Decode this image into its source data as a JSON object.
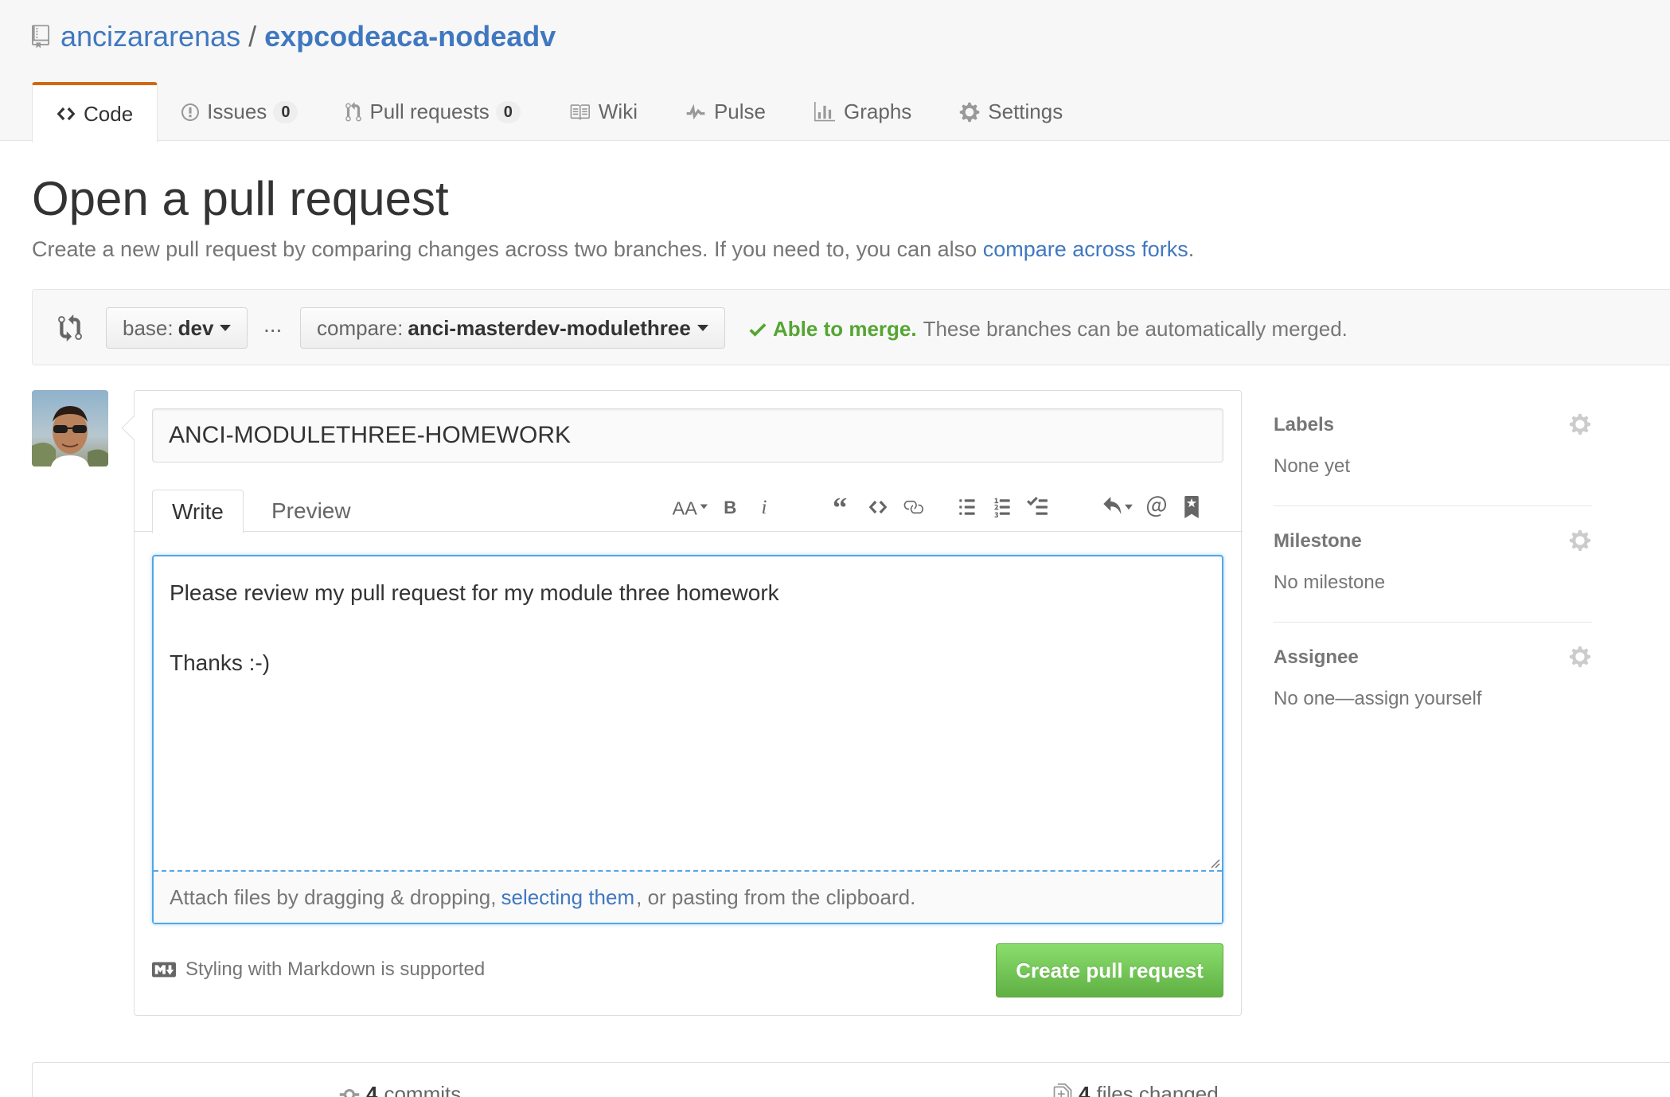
{
  "repo": {
    "owner": "ancizararenas",
    "separator": "/",
    "name": "expcodeaca-nodeadv"
  },
  "nav": {
    "code": "Code",
    "issues": "Issues",
    "issues_count": "0",
    "pulls": "Pull requests",
    "pulls_count": "0",
    "wiki": "Wiki",
    "pulse": "Pulse",
    "graphs": "Graphs",
    "settings": "Settings"
  },
  "page": {
    "title": "Open a pull request",
    "subtitle_prefix": "Create a new pull request by comparing changes across two branches. If you need to, you can also ",
    "subtitle_link": "compare across forks",
    "subtitle_suffix": "."
  },
  "range": {
    "base_label": "base:",
    "base_value": "dev",
    "dots": "...",
    "compare_label": "compare:",
    "compare_value": "anci-masterdev-modulethree",
    "merge_ok": "Able to merge.",
    "merge_text": "These branches can be automatically merged."
  },
  "form": {
    "title_value": "ANCI-MODULETHREE-HOMEWORK",
    "tab_write": "Write",
    "tab_preview": "Preview",
    "body": "Please review my pull request for my module three homework\n\nThanks :-)",
    "drag_prefix": "Attach files by dragging & dropping,",
    "drag_link": "selecting them",
    "drag_suffix": ", or pasting from the clipboard.",
    "markdown_note": "Styling with Markdown is supported",
    "submit": "Create pull request"
  },
  "sidebar": {
    "labels_heading": "Labels",
    "labels_value": "None yet",
    "milestone_heading": "Milestone",
    "milestone_value": "No milestone",
    "assignee_heading": "Assignee",
    "assignee_value": "No one—assign yourself"
  },
  "stats": {
    "commits_count": "4",
    "commits_label": "commits",
    "files_count": "4",
    "files_label": "files changed"
  },
  "colors": {
    "link": "#4078c0",
    "merge_ok": "#55a532",
    "focus": "#51a7e8",
    "create_button": "#60b044",
    "tab_accent": "#d26911"
  },
  "icons": {
    "repo": "repo-icon",
    "code": "code-icon",
    "issues": "issue-opened-icon",
    "pulls": "git-pull-request-icon",
    "wiki": "book-icon",
    "pulse": "pulse-icon",
    "graphs": "graph-icon",
    "settings": "gear-icon",
    "compare": "git-compare-icon",
    "check": "check-icon",
    "markdown": "markdown-icon"
  }
}
